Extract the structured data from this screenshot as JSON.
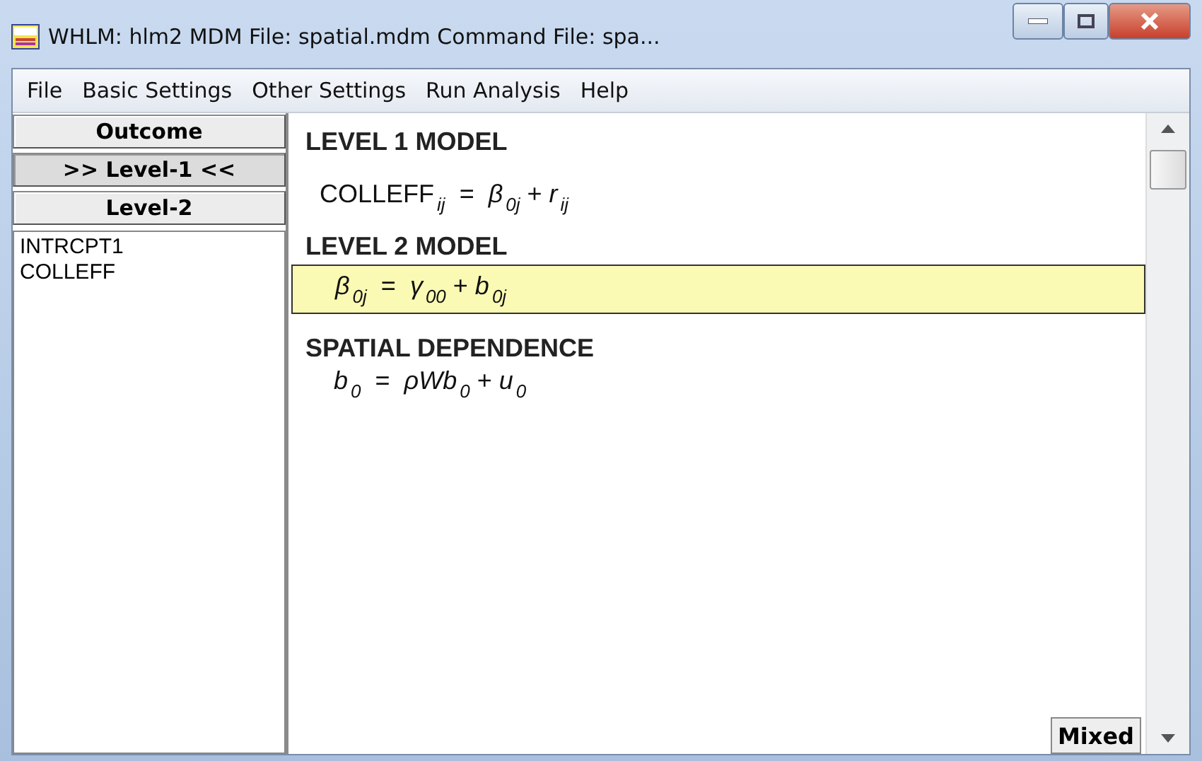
{
  "window": {
    "title": "WHLM: hlm2 MDM File: spatial.mdm  Command File: spa..."
  },
  "menu": [
    "File",
    "Basic Settings",
    "Other Settings",
    "Run Analysis",
    "Help"
  ],
  "level_buttons": [
    {
      "label": "Outcome",
      "selected": false
    },
    {
      "label": ">> Level-1 <<",
      "selected": true
    },
    {
      "label": "Level-2",
      "selected": false
    }
  ],
  "variables": [
    "INTRCPT1",
    "COLLEFF"
  ],
  "sections": [
    {
      "heading": "LEVEL 1 MODEL",
      "equation": "COLLEFF$_{ij}$  =  *β*$_{0j}$ + *r*$_{ij}$",
      "selected": false
    },
    {
      "heading": "LEVEL 2 MODEL",
      "equation": "*β*$_{0j}$  =  *γ*$_{00}$ + *b*$_{0j}$",
      "selected": true
    },
    {
      "heading": "SPATIAL DEPENDENCE",
      "equation": "*b*$_{0}$  =  *ρWb*$_{0}$ + *u*$_{0}$",
      "selected": false
    }
  ],
  "mode_button": "Mixed"
}
